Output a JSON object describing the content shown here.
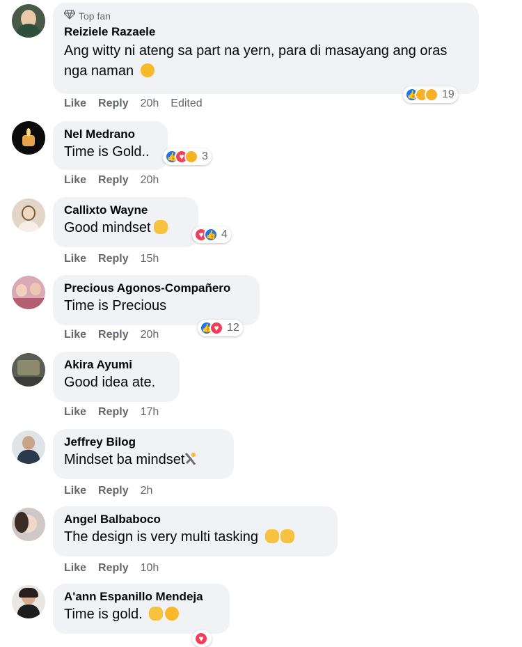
{
  "labels": {
    "like": "Like",
    "reply": "Reply"
  },
  "comments": [
    {
      "name": "Reiziele Razaele",
      "badge": "Top fan",
      "text": "Ang witty ni ateng sa part na yern, para di masayang ang oras nga naman",
      "emoji": "🤣",
      "time": "20h",
      "edited": "Edited",
      "reactions": [
        "like",
        "haha",
        "care"
      ],
      "count": "19"
    },
    {
      "name": "Nel Medrano",
      "text": "Time is Gold..",
      "time": "20h",
      "reactions": [
        "like",
        "love",
        "care"
      ],
      "count": "3"
    },
    {
      "name": "Callixto Wayne",
      "text": "Good mindset",
      "emoji": "👏",
      "time": "15h",
      "reactions": [
        "love",
        "like"
      ],
      "count": "4"
    },
    {
      "name": "Precious Agonos-Compañero",
      "text": "Time is Precious",
      "time": "20h",
      "reactions": [
        "like",
        "love"
      ],
      "count": "12"
    },
    {
      "name": "Akira Ayumi",
      "text": "Good idea ate.",
      "time": "17h"
    },
    {
      "name": "Jeffrey Bilog",
      "text": "Mindset ba mindset",
      "emoji": "🤸",
      "time": "2h"
    },
    {
      "name": "Angel Balbaboco",
      "text": "The design is very multi tasking",
      "emoji": "👏👏",
      "time": "10h"
    },
    {
      "name": "A'ann Espanillo Mendeja",
      "text": "Time is gold.",
      "emoji": "✌😊",
      "time": ""
    }
  ],
  "colors": {
    "like": "#1877f2",
    "love": "#f33e58",
    "care": "#f7b125",
    "bubble": "#f0f2f5",
    "meta": "#65676b"
  }
}
